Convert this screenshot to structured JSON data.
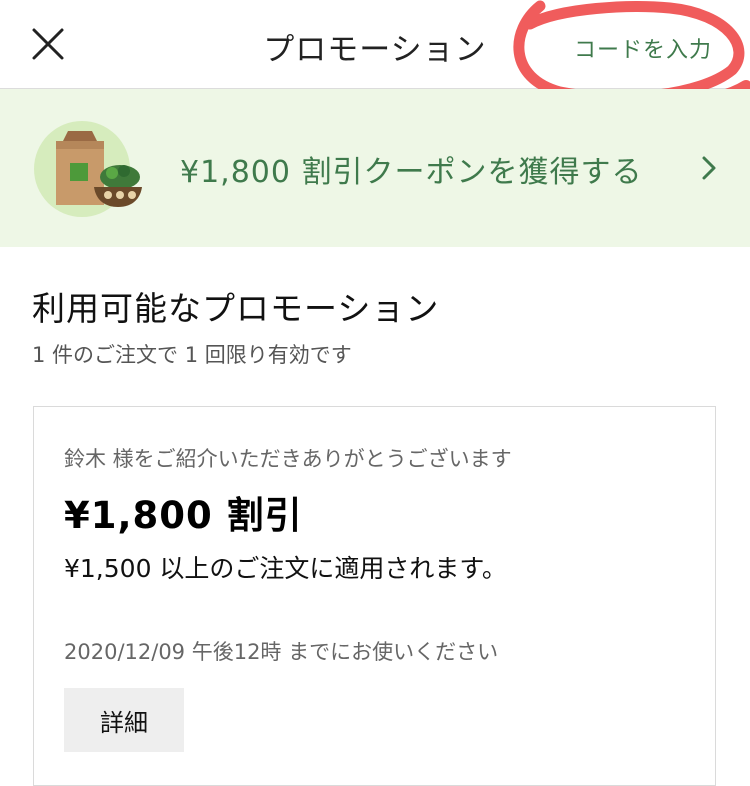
{
  "header": {
    "title": "プロモーション",
    "enter_code_label": "コードを入力",
    "close_icon": "close-icon"
  },
  "banner": {
    "text": "¥1,800 割引クーポンを獲得する",
    "icon": "grocery-bag-salad-icon",
    "chevron_icon": "chevron-right-icon",
    "accent_color": "#3f7a4c",
    "background_color": "#eef7e6"
  },
  "section": {
    "title": "利用可能なプロモーション",
    "subtitle": "1 件のご注文で 1 回限り有効です"
  },
  "promo_card": {
    "referral_text": "鈴木 様をご紹介いただきありがとうございます",
    "amount": "¥1,800 割引",
    "condition": "¥1,500 以上のご注文に適用されます。",
    "expiry": "2020/12/09 午後12時 までにお使いください",
    "details_label": "詳細"
  },
  "annotation_color": "#ee4a4a"
}
